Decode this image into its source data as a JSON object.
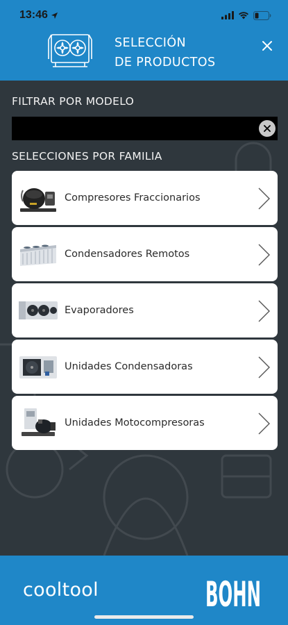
{
  "status": {
    "time": "13:46",
    "icons": [
      "location-arrow-icon",
      "cellular-signal-icon",
      "wifi-icon",
      "battery-icon"
    ]
  },
  "header": {
    "title_line1": "SELECCIÓN",
    "title_line2": "DE PRODUCTOS",
    "logo_icon": "refrigeration-unit-icon",
    "close_icon": "close-icon"
  },
  "filter": {
    "label": "FILTRAR POR MODELO",
    "value": "",
    "placeholder": ""
  },
  "families": {
    "label": "SELECCIONES POR FAMILIA",
    "items": [
      {
        "label": "Compresores Fraccionarios",
        "icon": "compressor-icon"
      },
      {
        "label": "Condensadores Remotos",
        "icon": "remote-condenser-icon"
      },
      {
        "label": "Evaporadores",
        "icon": "evaporator-icon"
      },
      {
        "label": "Unidades Condensadoras",
        "icon": "condensing-unit-icon"
      },
      {
        "label": "Unidades Motocompresoras",
        "icon": "motocompressor-unit-icon"
      }
    ]
  },
  "footer": {
    "app_name": "cooltool",
    "brand": "BOHN"
  },
  "colors": {
    "accent": "#1f87c8",
    "background": "#2f373d",
    "card": "#ffffff"
  }
}
